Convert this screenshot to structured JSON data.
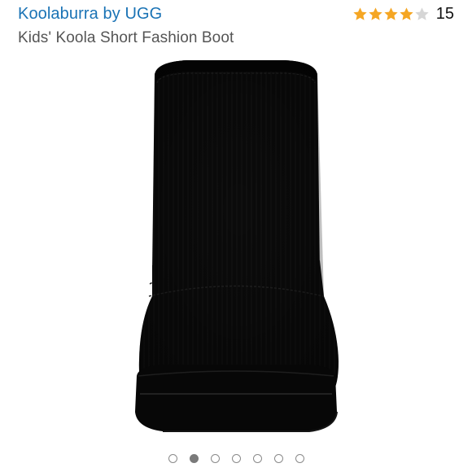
{
  "product": {
    "brand": "Koolaburra by UGG",
    "title": "Kids' Koola Short Fashion Boot",
    "image_icon": "black-suede-boot-image"
  },
  "rating": {
    "stars": 4,
    "max_stars": 5,
    "count": "15",
    "star_color": "#f5a623",
    "empty_star_color": "#d6d6d6"
  },
  "carousel": {
    "total": 7,
    "active_index": 1
  },
  "colors": {
    "brand_link": "#1a73b5",
    "title": "#555555"
  }
}
